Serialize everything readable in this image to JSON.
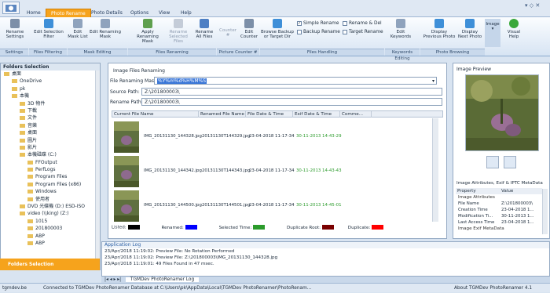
{
  "tabs": {
    "home": "Home",
    "photo_rename": "Photo Rename",
    "photo_details": "Photo Details",
    "options": "Options",
    "view": "View",
    "help": "Help"
  },
  "ribbon": {
    "rename_settings": "Rename\nSettings",
    "edit_selection_filter": "Edit Selection\nFilter",
    "edit_mask_list": "Edit\nMask List",
    "edit_renaming_mask": "Edit Renaming\nMask",
    "apply_renaming_mask": "Apply\nRenaming Mask",
    "rename_selected_files": "Rename\nSelected Files",
    "rename_all_files": "Rename\nAll Files",
    "counter": "Counter #",
    "edit_counter": "Edit\nCounter",
    "browse_backup": "Browse Backup\nor Target Dir",
    "simple_rename": "Simple Rename",
    "rename_del": "Rename & Del",
    "backup_rename": "Backup Rename",
    "target_rename": "Target Rename",
    "edit_keywords": "Edit\nKeywords",
    "display_previous": "Display\nPrevious Photo",
    "display_next": "Display\nNext Photo",
    "image": "Image",
    "visual_help": "Visual\nHelp"
  },
  "groups": {
    "settings": "Settings",
    "files_filtering": "Files Filtering",
    "mask_editing": "Mask Editing",
    "files_renaming": "Files Renaming",
    "picture_counter": "Picture Counter #",
    "files_handling": "Files Handling",
    "keywords_editing": "Keywords Editing",
    "photo_browsing": "Photo Browsing"
  },
  "folders": {
    "title": "Folders Selection",
    "items": [
      {
        "label": "桌面",
        "indent": 0
      },
      {
        "label": "OneDrive",
        "indent": 1
      },
      {
        "label": "pk",
        "indent": 1
      },
      {
        "label": "本機",
        "indent": 1
      },
      {
        "label": "3D 物件",
        "indent": 2
      },
      {
        "label": "下載",
        "indent": 2
      },
      {
        "label": "文件",
        "indent": 2
      },
      {
        "label": "音樂",
        "indent": 2
      },
      {
        "label": "桌面",
        "indent": 2
      },
      {
        "label": "圖片",
        "indent": 2
      },
      {
        "label": "影片",
        "indent": 2
      },
      {
        "label": "本機磁碟 (C:)",
        "indent": 2
      },
      {
        "label": "FFOutput",
        "indent": 3
      },
      {
        "label": "PerfLogs",
        "indent": 3
      },
      {
        "label": "Program Files",
        "indent": 3
      },
      {
        "label": "Program Files (x86)",
        "indent": 3
      },
      {
        "label": "Windows",
        "indent": 3
      },
      {
        "label": "使用者",
        "indent": 3
      },
      {
        "label": "DVD 光碟機 (D:) ESD-ISO",
        "indent": 2
      },
      {
        "label": "video (\\\\king) (Z:)",
        "indent": 2
      },
      {
        "label": "1015",
        "indent": 3
      },
      {
        "label": "201800003",
        "indent": 3
      },
      {
        "label": "ABP",
        "indent": 3
      },
      {
        "label": "ABP",
        "indent": 3
      }
    ],
    "button": "Folders Selection"
  },
  "renaming": {
    "title": "Image Files Renaming",
    "mask_label": "File Renaming Mask:",
    "mask_value": "%Y%m%d%H%M%S",
    "source_label": "Source Path:",
    "source_value": "Z:\\201800003\\",
    "rename_label": "Rename Path:",
    "rename_value": "Z:\\201800003\\"
  },
  "file_table": {
    "headers": [
      "Current File Name",
      "Renamed File Name",
      "File Date & Time",
      "Exif Date & Time",
      "Comme..."
    ],
    "rows": [
      [
        "IMG_20131130_144328.jpg",
        "20131130T144329.jpg",
        "23-04-2018 11-17-34",
        "30-11-2013 14-43-29",
        ""
      ],
      [
        "IMG_20131130_144342.jpg",
        "20131130T144343.jpg",
        "23-04-2018 11-17-34",
        "30-11-2013 14-43-43",
        ""
      ],
      [
        "IMG_20131130_144500.jpg",
        "20131130T144501.jpg",
        "23-04-2018 11-17-34",
        "30-11-2013 14-45-01",
        ""
      ]
    ]
  },
  "legend": {
    "listed": "Listed:",
    "renamed": "Renamed:",
    "selected_time": "Selected Time:",
    "duplicate_root": "Duplicate Root:",
    "duplicate": "Duplicate:"
  },
  "colors": {
    "listed": "#000000",
    "renamed": "#0000ff",
    "selected_time": "#2b9b2b",
    "duplicate_root": "#7a0000",
    "duplicate": "#ff0000",
    "accent": "#f6a31c"
  },
  "preview": {
    "title": "Image Preview"
  },
  "metadata": {
    "title": "Image Attributes, Exif & IPTC MetaData",
    "headers": [
      "Property",
      "Value"
    ],
    "section1": "Image Attributes",
    "rows": [
      [
        "File Name",
        "Z:\\201800003\\"
      ],
      [
        "Creation Time",
        "23-04-2018 1..."
      ],
      [
        "Modification Ti...",
        "30-11-2013 1..."
      ],
      [
        "Last Access Time",
        "23-04-2018 1..."
      ]
    ],
    "section2": "Image Exif MetaData"
  },
  "applog": {
    "title": "Application Log",
    "lines": [
      "23/Apr/2018 11:19:02: Preview File: No Rotation Performed",
      "23/Apr/2018 11:19:02: Preview File: Z:\\201800003\\IMG_20131130_144328.jpg",
      "23/Apr/2018 11:19:01: 49 Files Found in 47 msec."
    ],
    "tab": "TGMDev PhotoRenamer Log"
  },
  "status": {
    "left": "tgmdev.be",
    "message": "Connected to TGMDev PhotoRenamer Database at C:\\Users\\pk\\AppData\\Local\\TGMDev PhotoRenamer\\PhotoRenam...",
    "about": "About TGMDev PhotoRenamer 4.1"
  }
}
